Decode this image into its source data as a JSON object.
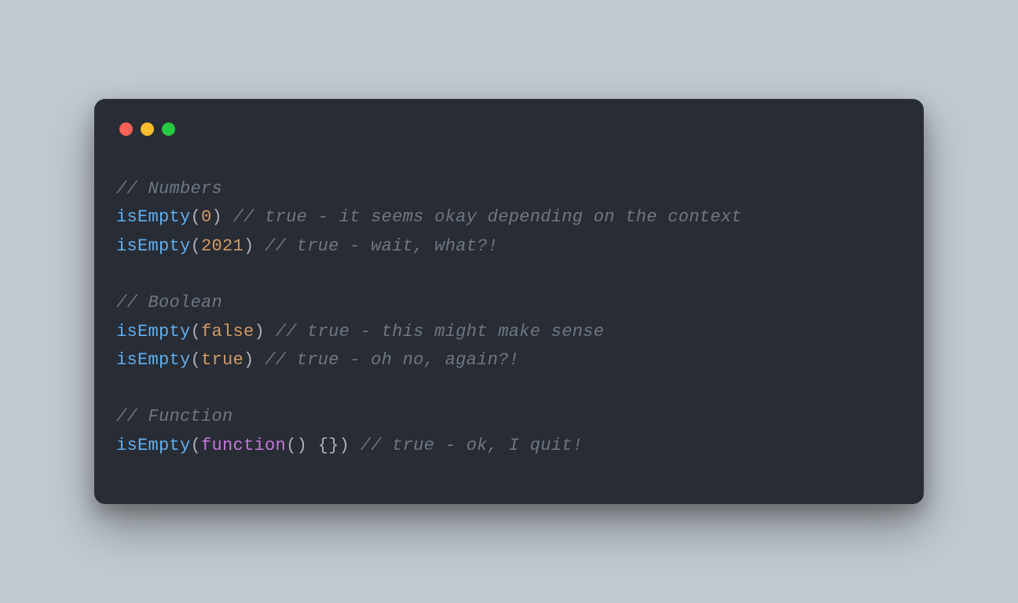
{
  "window": {
    "traffic_lights": [
      "red",
      "yellow",
      "green"
    ]
  },
  "code": {
    "lines": [
      {
        "type": "comment",
        "text": "// Numbers"
      },
      {
        "type": "call-num",
        "fn": "isEmpty",
        "arg": "0",
        "comment": "// true - it seems okay depending on the context"
      },
      {
        "type": "call-num",
        "fn": "isEmpty",
        "arg": "2021",
        "comment": "// true - wait, what?!"
      },
      {
        "type": "blank"
      },
      {
        "type": "comment",
        "text": "// Boolean"
      },
      {
        "type": "call-bool",
        "fn": "isEmpty",
        "arg": "false",
        "comment": "// true - this might make sense"
      },
      {
        "type": "call-bool",
        "fn": "isEmpty",
        "arg": "true",
        "comment": "// true - oh no, again?!"
      },
      {
        "type": "blank"
      },
      {
        "type": "comment",
        "text": "// Function"
      },
      {
        "type": "call-func",
        "fn": "isEmpty",
        "kw": "function",
        "body": "() {}",
        "comment": "// true - ok, I quit!"
      }
    ]
  }
}
